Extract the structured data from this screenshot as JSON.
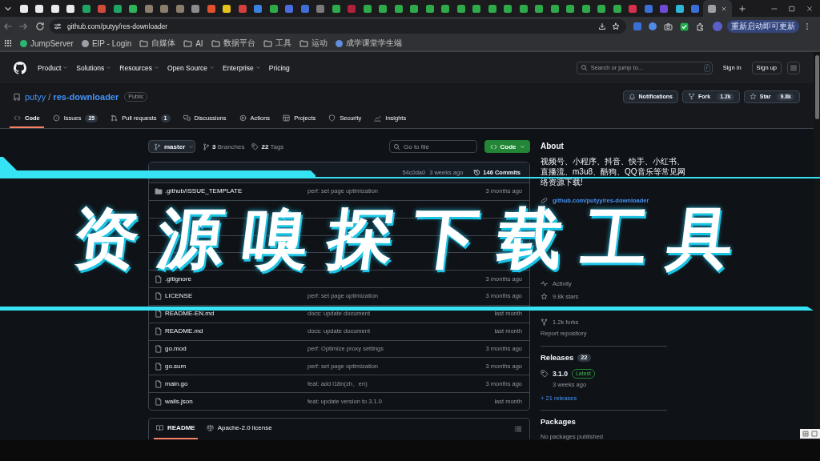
{
  "browser": {
    "tabs": [
      {
        "color": "#e8eaed",
        "selected": false
      },
      {
        "color": "#e8eaed",
        "selected": false
      },
      {
        "color": "#e8eaed",
        "selected": false
      },
      {
        "color": "#e8eaed",
        "selected": false
      },
      {
        "color": "#1fa463",
        "selected": false
      },
      {
        "color": "#d24b3a",
        "selected": false
      },
      {
        "color": "#1fa463",
        "selected": false
      },
      {
        "color": "#2fb35a",
        "selected": false
      },
      {
        "color": "#8b7d6b",
        "selected": false
      },
      {
        "color": "#8b7d6b",
        "selected": false
      },
      {
        "color": "#8b7d6b",
        "selected": false
      },
      {
        "color": "#8b8b8b",
        "selected": false
      },
      {
        "color": "#e0522d",
        "selected": false
      },
      {
        "color": "#e5c31a",
        "selected": false
      },
      {
        "color": "#d23f3f",
        "selected": false
      },
      {
        "color": "#3b82e0",
        "selected": false
      },
      {
        "color": "#2eaa4a",
        "selected": false
      },
      {
        "color": "#4b6be0",
        "selected": false
      },
      {
        "color": "#3d6fd6",
        "selected": false
      },
      {
        "color": "#7a7a7a",
        "selected": false
      },
      {
        "color": "#2eaa4a",
        "selected": false
      },
      {
        "color": "#b0213a",
        "selected": false
      },
      {
        "color": "#2eaa4a",
        "selected": false
      },
      {
        "color": "#2eaa4a",
        "selected": false
      },
      {
        "color": "#2eaa4a",
        "selected": false
      },
      {
        "color": "#2eaa4a",
        "selected": false
      },
      {
        "color": "#2eaa4a",
        "selected": false
      },
      {
        "color": "#2eaa4a",
        "selected": false
      },
      {
        "color": "#2eaa4a",
        "selected": false
      },
      {
        "color": "#2eaa4a",
        "selected": false
      },
      {
        "color": "#2eaa4a",
        "selected": false
      },
      {
        "color": "#2eaa4a",
        "selected": false
      },
      {
        "color": "#2eaa4a",
        "selected": false
      },
      {
        "color": "#2eaa4a",
        "selected": false
      },
      {
        "color": "#2eaa4a",
        "selected": false
      },
      {
        "color": "#2eaa4a",
        "selected": false
      },
      {
        "color": "#2eaa4a",
        "selected": false
      },
      {
        "color": "#2eaa4a",
        "selected": false
      },
      {
        "color": "#2eaa4a",
        "selected": false
      },
      {
        "color": "#d8304a",
        "selected": false
      },
      {
        "color": "#3b6fd8",
        "selected": false
      },
      {
        "color": "#6d4bd6",
        "selected": false
      },
      {
        "color": "#2fb5d8",
        "selected": false
      },
      {
        "color": "#3b6fd8",
        "selected": false
      },
      {
        "color": "#9aa0a6",
        "selected": true
      }
    ],
    "address": {
      "url": "github.com/putyy/res-downloader"
    },
    "update_button": "重新启动即可更新",
    "bookmarks": [
      {
        "kind": "site",
        "label": "JumpServer",
        "color": "#2bb673"
      },
      {
        "kind": "site",
        "label": "EIP - Login",
        "color": "#9aa0a6"
      },
      {
        "kind": "folder",
        "label": "自媒体"
      },
      {
        "kind": "folder",
        "label": "AI"
      },
      {
        "kind": "folder",
        "label": "数据平台"
      },
      {
        "kind": "folder",
        "label": "工具"
      },
      {
        "kind": "folder",
        "label": "运动"
      },
      {
        "kind": "site",
        "label": "成学课堂学生端",
        "color": "#5f8fd9"
      }
    ]
  },
  "github_header": {
    "nav": [
      {
        "label": "Product",
        "dropdown": true
      },
      {
        "label": "Solutions",
        "dropdown": true
      },
      {
        "label": "Resources",
        "dropdown": true
      },
      {
        "label": "Open Source",
        "dropdown": true
      },
      {
        "label": "Enterprise",
        "dropdown": true
      },
      {
        "label": "Pricing",
        "dropdown": false
      }
    ],
    "search": {
      "placeholder": "Search or jump to...",
      "shortcut": "/"
    },
    "sign_in": "Sign in",
    "sign_up": "Sign up"
  },
  "repo": {
    "owner": "putyy",
    "separator": "/",
    "name": "res-downloader",
    "visibility": "Public",
    "notifications": "Notifications",
    "fork": {
      "label": "Fork",
      "count": "1.2k"
    },
    "star": {
      "label": "Star",
      "count": "9.8k"
    }
  },
  "repo_tabs": [
    {
      "label": "Code",
      "selected": true
    },
    {
      "label": "Issues",
      "count": "25",
      "selected": false
    },
    {
      "label": "Pull requests",
      "count": "1",
      "selected": false
    },
    {
      "label": "Discussions",
      "selected": false
    },
    {
      "label": "Actions",
      "selected": false
    },
    {
      "label": "Projects",
      "selected": false
    },
    {
      "label": "Security",
      "selected": false
    },
    {
      "label": "Insights",
      "selected": false
    }
  ],
  "code": {
    "branch": "master",
    "branches": "**3** Branches",
    "tags": "**22** Tags",
    "file_search": {
      "placeholder": "Go to file"
    },
    "code_button": "Code",
    "latest_commit": {
      "hash": "54c0da0",
      "time": "3 weeks ago",
      "commits": "146 Commits"
    },
    "files": [
      {
        "kind": "folder",
        "name": ".github/ISSUE_TEMPLATE",
        "message": "perf: set page optimization",
        "time": "3 months ago"
      },
      {
        "kind": "covered"
      },
      {
        "kind": "covered"
      },
      {
        "kind": "covered"
      },
      {
        "kind": "covered"
      },
      {
        "kind": "file",
        "name": ".gitignore",
        "time": "3 months ago"
      },
      {
        "kind": "file",
        "name": "LICENSE",
        "message": "perf: set page optimization",
        "time": "3 months ago"
      },
      {
        "kind": "file",
        "name": "README-EN.md",
        "message": "docs: update document",
        "time": "last month"
      },
      {
        "kind": "file",
        "name": "README.md",
        "message": "docs: update document",
        "time": "last month"
      },
      {
        "kind": "file",
        "name": "go.mod",
        "message": "perf: Optimize proxy settings",
        "time": "3 months ago"
      },
      {
        "kind": "file",
        "name": "go.sum",
        "message": "perf: set page optimization",
        "time": "3 months ago"
      },
      {
        "kind": "file",
        "name": "main.go",
        "message": "feat: add i18n(zh、en)",
        "time": "3 months ago"
      },
      {
        "kind": "file",
        "name": "wails.json",
        "message": "feat: update version to 3.1.0",
        "time": "last month"
      }
    ],
    "readme_tabs": [
      {
        "label": "README",
        "selected": true
      },
      {
        "label": "Apache-2.0 license",
        "selected": false
      }
    ]
  },
  "about": {
    "heading": "About",
    "description": "视频号、小程序、抖音、快手、小红书、直播流、m3u8、酷狗、QQ音乐等常见网络资源下载!",
    "meta": [
      {
        "kind": "link",
        "text": "github.com/putyy/res-downloader"
      },
      {
        "kind": "covered"
      },
      {
        "kind": "covered"
      },
      {
        "kind": "covered"
      },
      {
        "kind": "covered"
      },
      {
        "kind": "covered"
      },
      {
        "kind": "activity",
        "text": "Activity"
      },
      {
        "kind": "stars",
        "text": "9.8k stars"
      },
      {
        "kind": "covered"
      },
      {
        "kind": "forks",
        "text": "1.2k forks"
      }
    ],
    "report": "Report repository"
  },
  "releases": {
    "heading": "Releases",
    "count": "22",
    "latest": {
      "tag": "3.1.0",
      "badge": "Latest",
      "time": "3 weeks ago"
    },
    "more": "+ 21 releases"
  },
  "packages": {
    "heading": "Packages",
    "note": "No packages published"
  },
  "banner": {
    "title": "资源嗅探下载工具"
  }
}
